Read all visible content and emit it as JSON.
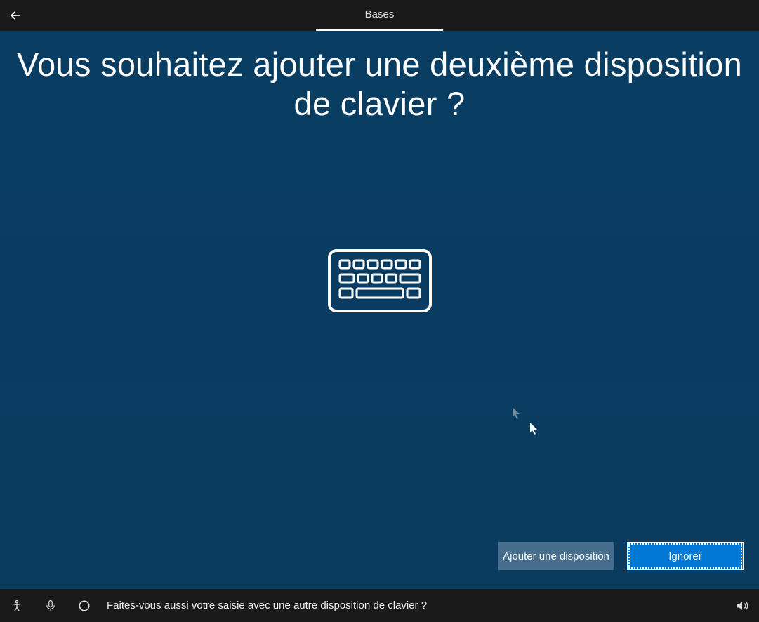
{
  "topbar": {
    "tab_label": "Bases"
  },
  "main": {
    "heading": "Vous souhaitez ajouter une deuxième disposition de clavier ?"
  },
  "buttons": {
    "add_layout": "Ajouter une disposition",
    "skip": "Ignorer"
  },
  "bottombar": {
    "prompt": "Faites-vous aussi votre saisie avec une autre disposition de clavier ?"
  }
}
